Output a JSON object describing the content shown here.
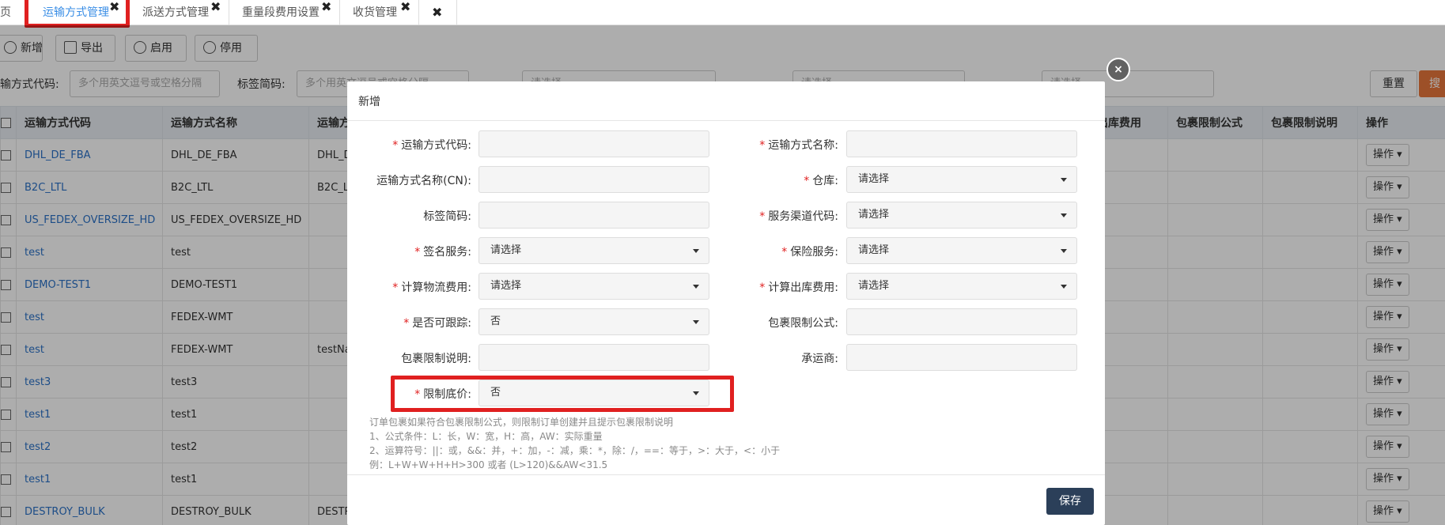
{
  "tabs": [
    {
      "label": "页"
    },
    {
      "label": "运输方式管理",
      "close": "✖"
    },
    {
      "label": "派送方式管理",
      "close": "✖"
    },
    {
      "label": "重量段费用设置",
      "close": "✖"
    },
    {
      "label": "收货管理",
      "close": "✖"
    },
    {
      "label": "",
      "close": "✖"
    }
  ],
  "toolbar": {
    "add": "新增",
    "export": "导出",
    "enable": "启用",
    "disable": "停用"
  },
  "filters": {
    "code_label": "输方式代码:",
    "code_placeholder": "多个用英文逗号或空格分隔",
    "tag_label": "标签简码:",
    "tag_placeholder": "多个用英文逗号或空格分隔",
    "select_placeholder": "请选择",
    "reset": "重置",
    "search": "搜"
  },
  "table": {
    "headers": [
      "运输方式代码",
      "运输方式名称",
      "运输方",
      "出库费用",
      "包裹限制公式",
      "包裹限制说明",
      "操作"
    ],
    "op_label": "操作",
    "rows": [
      {
        "code": "DHL_DE_FBA",
        "name": "DHL_DE_FBA",
        "c3": "DHL_D"
      },
      {
        "code": "B2C_LTL",
        "name": "B2C_LTL",
        "c3": "B2C_LT"
      },
      {
        "code": "US_FEDEX_OVERSIZE_HD",
        "name": "US_FEDEX_OVERSIZE_HD",
        "c3": ""
      },
      {
        "code": "test",
        "name": "test",
        "c3": ""
      },
      {
        "code": "DEMO-TEST1",
        "name": "DEMO-TEST1",
        "c3": ""
      },
      {
        "code": "test",
        "name": "FEDEX-WMT",
        "c3": ""
      },
      {
        "code": "test",
        "name": "FEDEX-WMT",
        "c3": "testNa"
      },
      {
        "code": "test3",
        "name": "test3",
        "c3": ""
      },
      {
        "code": "test1",
        "name": "test1",
        "c3": ""
      },
      {
        "code": "test2",
        "name": "test2",
        "c3": ""
      },
      {
        "code": "test1",
        "name": "test1",
        "c3": ""
      },
      {
        "code": "DESTROY_BULK",
        "name": "DESTROY_BULK",
        "c3": "DESTRO"
      }
    ]
  },
  "modal": {
    "title": "新增",
    "close": "×",
    "fields": {
      "ship_code": "运输方式代码:",
      "ship_name": "运输方式名称:",
      "ship_name_cn": "运输方式名称(CN):",
      "warehouse": "仓库:",
      "tag_code": "标签简码:",
      "channel_code": "服务渠道代码:",
      "signature": "签名服务:",
      "insurance": "保险服务:",
      "logistics_fee": "计算物流费用:",
      "outbound_fee": "计算出库费用:",
      "trackable": "是否可跟踪:",
      "parcel_formula": "包裹限制公式:",
      "parcel_desc": "包裹限制说明:",
      "carrier": "承运商:",
      "min_price": "限制底价:"
    },
    "required_mark": "*",
    "select_placeholder": "请选择",
    "no_value": "否",
    "hints": [
      "订单包裹如果符合包裹限制公式，则限制订单创建并且提示包裹限制说明",
      "1、公式条件：L：长，W：宽，H：高，AW：实际重量",
      "2、运算符号：||：或，&&：并，+：加，-：减，乘：*，除：/，==：等于，>：大于，<：小于",
      "例：L+W+W+H+H>300 或者 (L>120)&&AW<31.5"
    ],
    "save": "保存"
  },
  "colors": {
    "highlight": "#e02020",
    "link": "#2b72c8",
    "save_button": "#2b3f59",
    "search_button": "#e8773b"
  }
}
